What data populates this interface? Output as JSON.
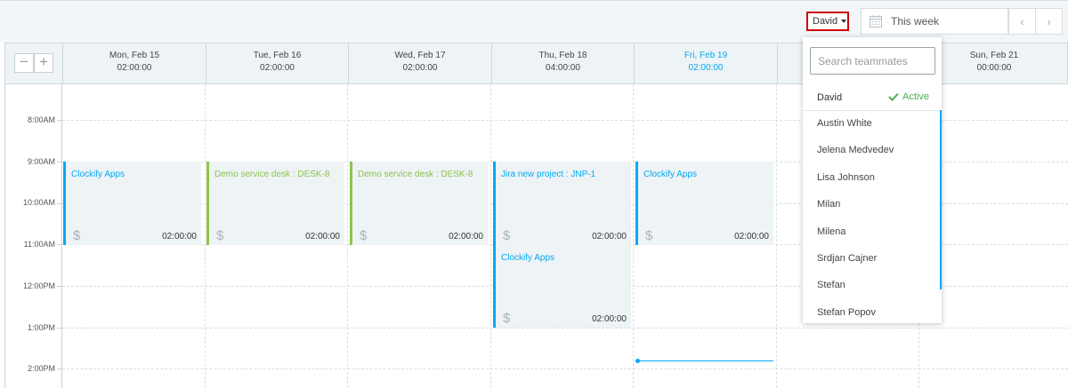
{
  "toolbar": {
    "user_selected": "David",
    "week_range": "This week",
    "prev_label": "‹",
    "next_label": "›"
  },
  "zoom": {
    "out_label": "−",
    "in_label": "+"
  },
  "days": [
    {
      "date": "Mon, Feb 15",
      "total": "02:00:00"
    },
    {
      "date": "Tue, Feb 16",
      "total": "02:00:00"
    },
    {
      "date": "Wed, Feb 17",
      "total": "02:00:00"
    },
    {
      "date": "Thu, Feb 18",
      "total": "04:00:00"
    },
    {
      "date": "Fri, Feb 19",
      "total": "02:00:00"
    },
    {
      "date": "",
      "total": ""
    },
    {
      "date": "Sun, Feb 21",
      "total": "00:00:00"
    }
  ],
  "time_labels": [
    "8:00AM",
    "9:00AM",
    "10:00AM",
    "11:00AM",
    "12:00PM",
    "1:00PM",
    "2:00PM"
  ],
  "events": [
    {
      "title": "Clockify Apps",
      "billable_symbol": "$",
      "duration": "02:00:00"
    },
    {
      "title": "Demo service desk : DESK-8",
      "billable_symbol": "$",
      "duration": "02:00:00"
    },
    {
      "title": "Demo service desk : DESK-8",
      "billable_symbol": "$",
      "duration": "02:00:00"
    },
    {
      "title": "Jira new project : JNP-1",
      "billable_symbol": "$",
      "duration": "02:00:00"
    },
    {
      "title": "Clockify Apps",
      "billable_symbol": "$",
      "duration": "02:00:00"
    },
    {
      "title": "Clockify Apps",
      "billable_symbol": "$",
      "duration": "02:00:00"
    }
  ],
  "teammates": {
    "search_placeholder": "Search teammates",
    "current": {
      "name": "David",
      "status": "Active"
    },
    "members": [
      "Austin White",
      "Jelena Medvedev",
      "Lisa Johnson",
      "Milan",
      "Milena",
      "Srdjan Cajner",
      "Stefan",
      "Stefan Popov"
    ]
  },
  "colors": {
    "accent": "#03a9f4",
    "green": "#8bc34a",
    "active": "#4caf50",
    "highlight_border": "#cc0000"
  }
}
